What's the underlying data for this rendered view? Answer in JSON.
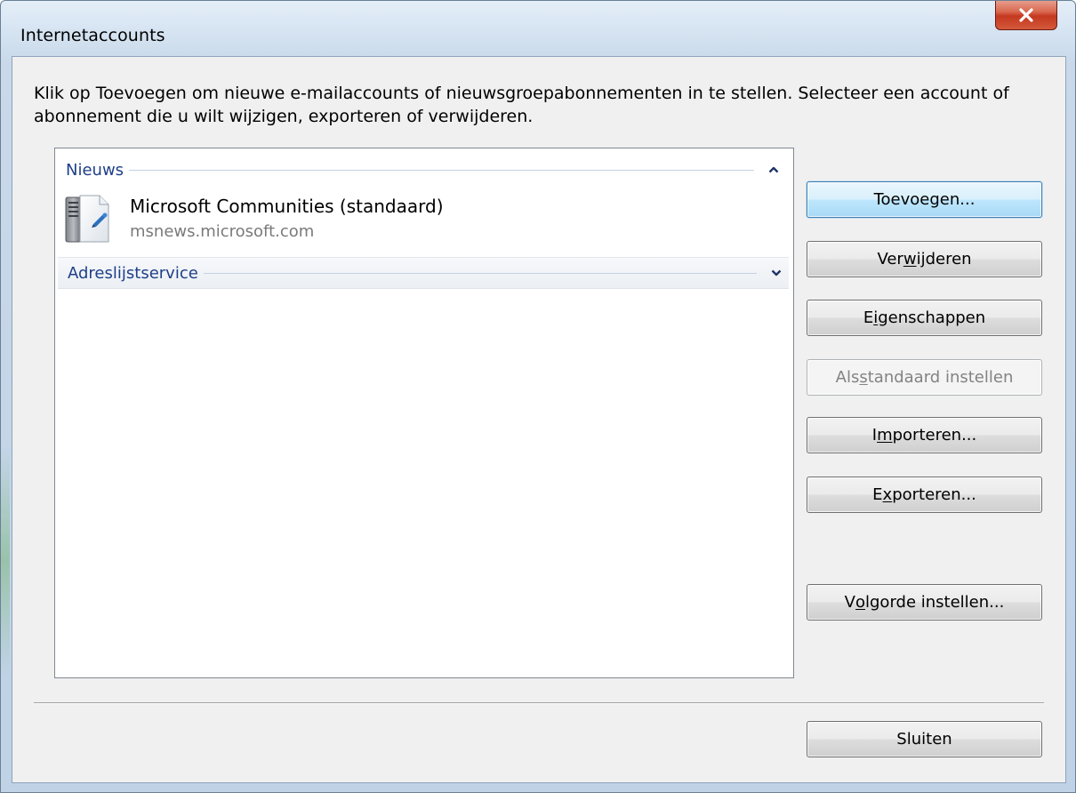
{
  "window": {
    "title": "Internetaccounts"
  },
  "instructions": {
    "text": "Klik op Toevoegen om nieuwe e-mailaccounts of nieuwsgroepabonnementen in te stellen. Selecteer een account of abonnement die u wilt wijzigen, exporteren of verwijderen."
  },
  "list": {
    "groups": [
      {
        "label": "Nieuws",
        "state": "expanded",
        "items": [
          {
            "name": "Microsoft Communities (standaard)",
            "server": "msnews.microsoft.com",
            "icon": "news-server-icon"
          }
        ]
      },
      {
        "label": "Adreslijstservice",
        "state": "collapsed",
        "items": []
      }
    ]
  },
  "buttons": {
    "add": {
      "pre": "Toevoegen...",
      "key": "",
      "post": ""
    },
    "remove": {
      "pre": "Ver",
      "key": "w",
      "post": "ijderen"
    },
    "properties": {
      "pre": "E",
      "key": "i",
      "post": "genschappen"
    },
    "set_default": {
      "pre": "Als ",
      "key": "s",
      "post": "tandaard instellen"
    },
    "import": {
      "pre": "I",
      "key": "m",
      "post": "porteren..."
    },
    "export": {
      "pre": "E",
      "key": "x",
      "post": "porteren..."
    },
    "set_order": {
      "pre": "V",
      "key": "o",
      "post": "lgorde instellen..."
    },
    "close": {
      "pre": "Sluiten",
      "key": "",
      "post": ""
    }
  },
  "colors": {
    "group_header_text": "#1e3f88",
    "default_button_border": "#3c7fb1",
    "close_button": "#c4391f",
    "secondary_text": "#7a7a7a"
  }
}
